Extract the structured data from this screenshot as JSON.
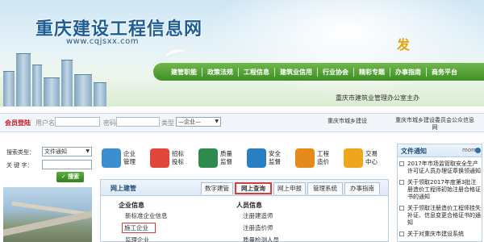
{
  "banner": {
    "title": "重庆建设工程信息网",
    "url": "www.cqjsxx.com",
    "deco_text": "发",
    "host": "重庆市建筑业管理办公室主办"
  },
  "nav": {
    "items": [
      "建管职能",
      "政策法规",
      "工程信息",
      "建筑业信用",
      "行业协会",
      "精彩专题",
      "办事指南",
      "商务平台"
    ]
  },
  "login": {
    "title": "会员登陆",
    "username_label": "用户名",
    "password_label": "密码",
    "type_label": "类型",
    "type_value": "—企业—",
    "link_1": "重庆市城乡建设",
    "link_2": "重庆市城乡建设委员会公众信息",
    "link_2b": "网"
  },
  "search": {
    "type_label": "搜索类型：",
    "type_value": "文件通知",
    "keyword_label": "关 键 字：",
    "button_label": "搜索"
  },
  "icons": [
    {
      "l1": "企业",
      "l2": "管理",
      "icon": "enterprise-icon",
      "color": "#3b8fd0"
    },
    {
      "l1": "招标",
      "l2": "投标",
      "icon": "bidding-icon",
      "color": "#e1463b"
    },
    {
      "l1": "质量",
      "l2": "监督",
      "icon": "quality-icon",
      "color": "#2f8a4d"
    },
    {
      "l1": "安全",
      "l2": "监督",
      "icon": "safety-icon",
      "color": "#2a7fc2"
    },
    {
      "l1": "工程",
      "l2": "造价",
      "icon": "cost-icon",
      "color": "#e68a1c"
    },
    {
      "l1": "交易",
      "l2": "中心",
      "icon": "trade-icon",
      "color": "#f0a51d"
    }
  ],
  "panel": {
    "title": "网上建管",
    "tabs": [
      "数字建管",
      "网上查询",
      "网上申报",
      "管理系统",
      "办事指南"
    ],
    "col1": {
      "head": "企业信息",
      "items": [
        "新标准企业信息",
        "施工企业",
        "监理企业"
      ]
    },
    "col2": {
      "head": "人员信息",
      "items": [
        "注册建造师",
        "注册造价师",
        "质量检测人员"
      ]
    }
  },
  "news": {
    "title": "文件通知",
    "more": "more",
    "items": [
      "2017年市场监管取安全生产许可证人员办理证章换领通知",
      "关于领取2017年度第3批注册造价工程师初始注册合格证书的通知",
      "关于领取注册造价工程师挂失补证、信息变更合格证书的通知",
      "关于对重庆市建设系统"
    ]
  },
  "colors": {
    "nav_green": "#3f8d27",
    "title_blue": "#1d5e96",
    "login_red": "#c0191f",
    "highlight_red": "#d53b3b"
  }
}
